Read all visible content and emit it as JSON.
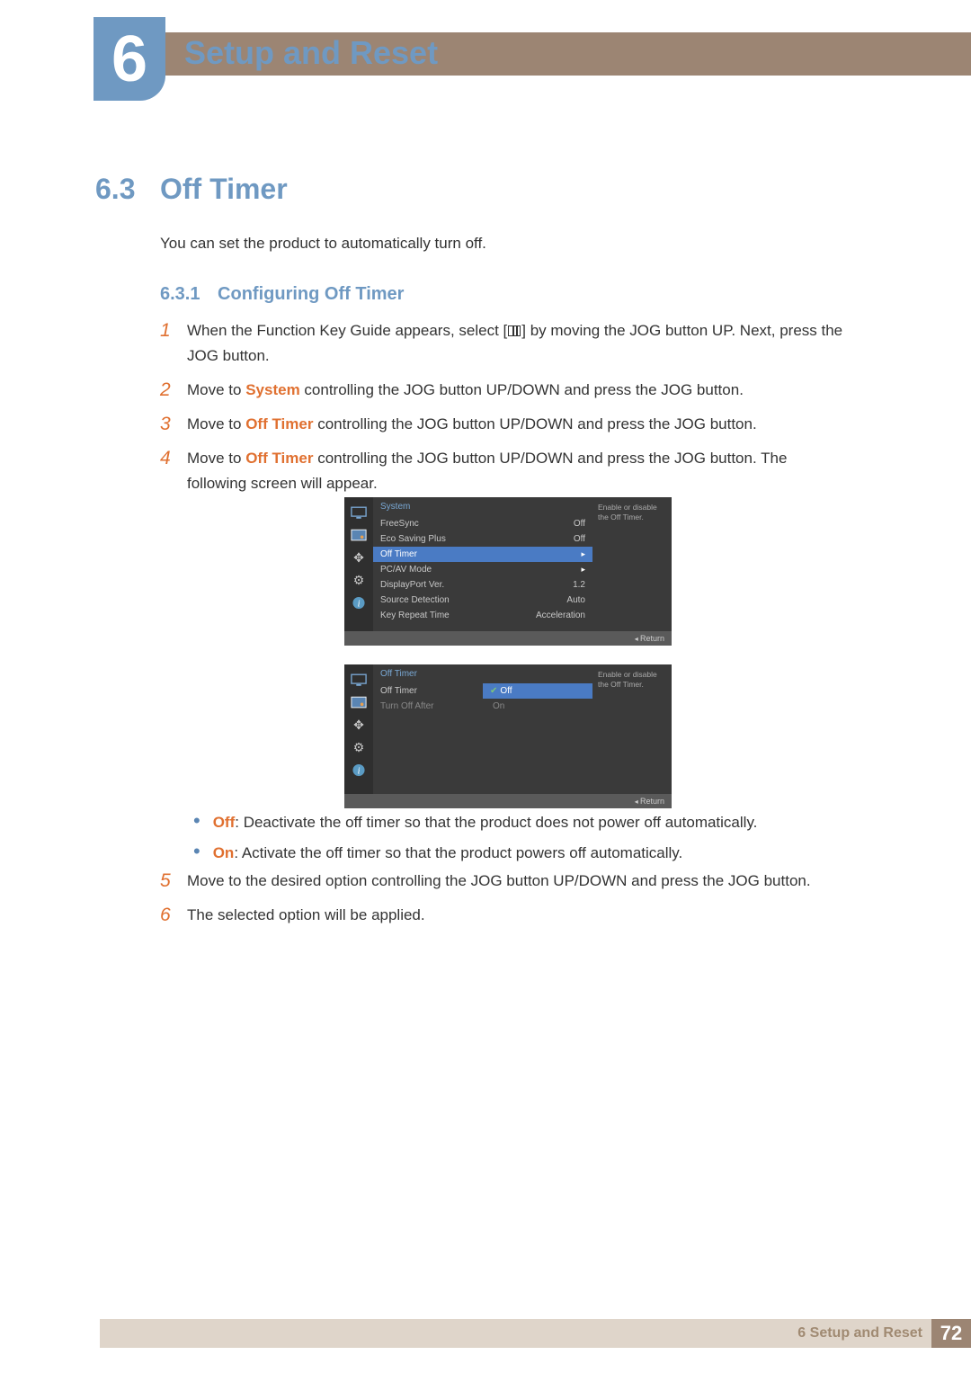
{
  "chapter": {
    "number": "6",
    "title": "Setup and Reset"
  },
  "section": {
    "number": "6.3",
    "title": "Off Timer",
    "intro": "You can set the product to automatically turn off."
  },
  "subsection": {
    "number": "6.3.1",
    "title": "Configuring Off Timer"
  },
  "steps": {
    "s1a": "When the Function Key Guide appears, select [",
    "s1b": "] by moving the JOG button UP. Next, press the JOG button.",
    "s2a": "Move to ",
    "s2hl": "System",
    "s2b": " controlling the JOG button UP/DOWN and press the JOG button.",
    "s3a": "Move to ",
    "s3hl": "Off Timer",
    "s3b": " controlling the JOG button UP/DOWN and press the JOG button.",
    "s4a": "Move to ",
    "s4hl": "Off Timer",
    "s4b": " controlling the JOG button UP/DOWN and press the JOG button. The following screen will appear.",
    "s5": "Move to the desired option controlling the JOG button UP/DOWN and press the JOG button.",
    "s6": "The selected option will be applied.",
    "n1": "1",
    "n2": "2",
    "n3": "3",
    "n4": "4",
    "n5": "5",
    "n6": "6"
  },
  "bullets": {
    "off_l": "Off",
    "off_t": ": Deactivate the off timer so that the product does not power off automatically.",
    "on_l": "On",
    "on_t": ": Activate the off timer so that the product powers off automatically."
  },
  "osd1": {
    "header": "System",
    "help": "Enable or disable the Off Timer.",
    "return": "Return",
    "rows": {
      "r1l": "FreeSync",
      "r1v": "Off",
      "r2l": "Eco Saving Plus",
      "r2v": "Off",
      "r3l": "Off Timer",
      "r3v": "▸",
      "r4l": "PC/AV Mode",
      "r4v": "▸",
      "r5l": "DisplayPort Ver.",
      "r5v": "1.2",
      "r6l": "Source Detection",
      "r6v": "Auto",
      "r7l": "Key Repeat Time",
      "r7v": "Acceleration"
    }
  },
  "osd2": {
    "header": "Off Timer",
    "help": "Enable or disable the Off Timer.",
    "return": "Return",
    "rows": {
      "r1l": "Off Timer",
      "r1v": "Off",
      "r2l": "Turn Off After",
      "r2v": "On"
    }
  },
  "footer": {
    "label": "6 Setup and Reset",
    "page": "72"
  }
}
